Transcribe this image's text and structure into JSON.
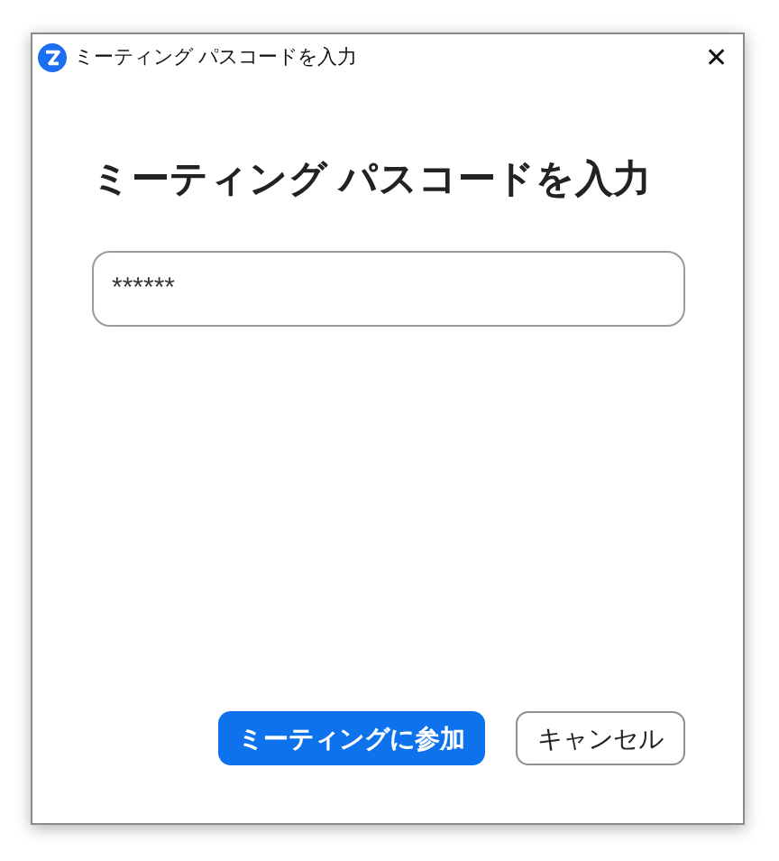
{
  "window": {
    "title": "ミーティング パスコードを入力",
    "close": "✕"
  },
  "heading": "ミーティング パスコードを入力",
  "passcode_field": {
    "value": "******"
  },
  "buttons": [
    {
      "label": "ミーティングに参加",
      "kind": "primary"
    },
    {
      "label": "キャンセル",
      "kind": "secondary"
    }
  ]
}
